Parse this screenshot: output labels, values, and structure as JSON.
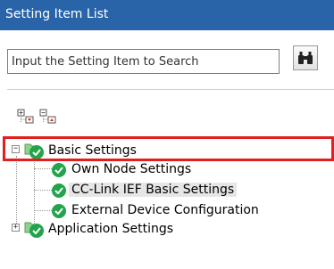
{
  "window": {
    "title": "Setting Item List"
  },
  "search": {
    "placeholder": "Input the Setting Item to Search",
    "button_icon": "binoculars-icon"
  },
  "toolbar": {
    "expand_icon": "expand-all-icon",
    "collapse_icon": "collapse-all-icon"
  },
  "tree": {
    "basic": {
      "label": "Basic Settings",
      "expander": "−",
      "children": [
        {
          "label": "Own Node Settings"
        },
        {
          "label": "CC-Link IEF Basic Settings"
        },
        {
          "label": "External Device Configuration"
        }
      ]
    },
    "application": {
      "label": "Application Settings",
      "expander": "+"
    }
  },
  "colors": {
    "header": "#2a64a8",
    "check": "#22a44a",
    "highlight": "#e02020"
  }
}
